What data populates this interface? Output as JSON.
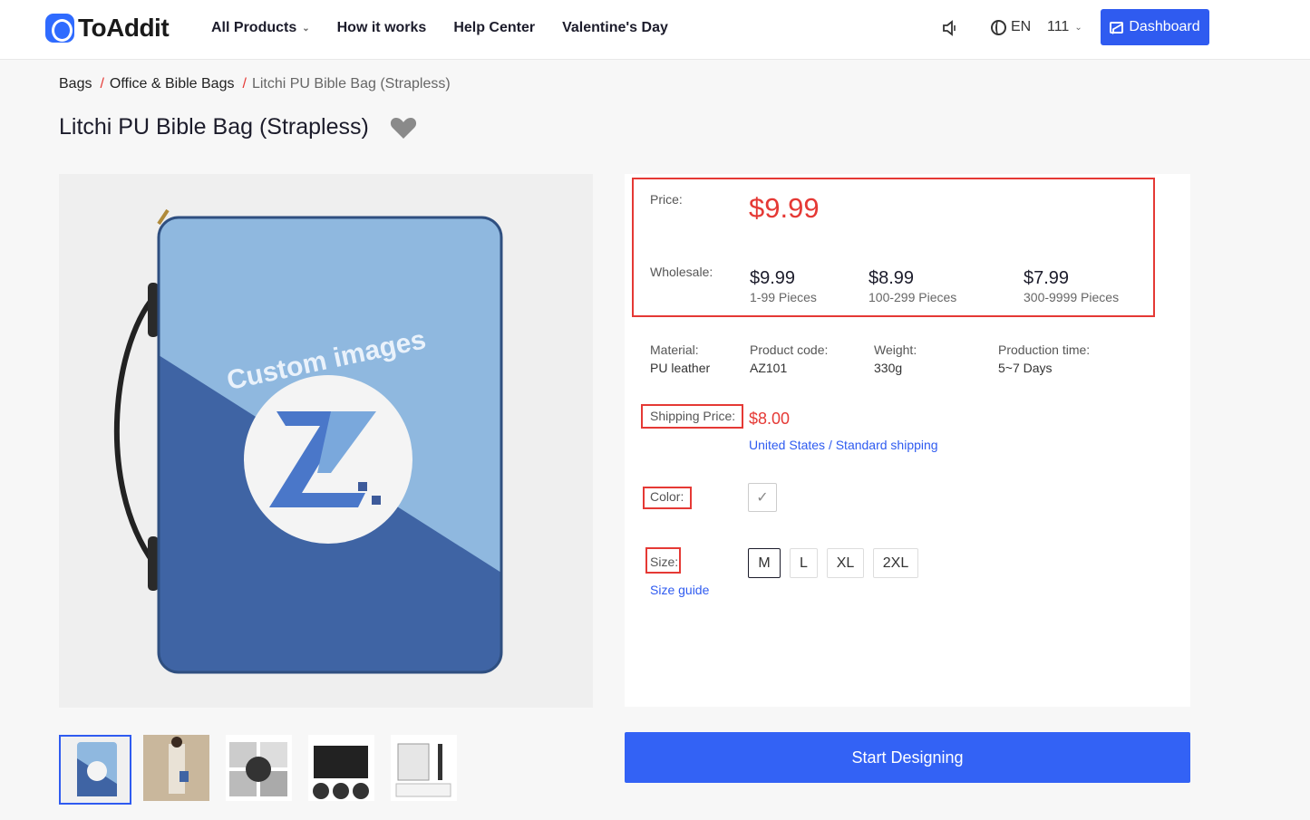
{
  "header": {
    "logo_text": "ToAddit",
    "nav": [
      {
        "label": "All Products",
        "has_dropdown": true
      },
      {
        "label": "How it works"
      },
      {
        "label": "Help Center"
      },
      {
        "label": "Valentine's Day"
      }
    ],
    "language": "EN",
    "user": "111",
    "dashboard_label": "Dashboard",
    "accent_color": "#2f5bf0"
  },
  "breadcrumb": {
    "items": [
      "Bags",
      "Office & Bible Bags"
    ],
    "separator": "/",
    "current": "Litchi PU Bible Bag (Strapless)"
  },
  "product": {
    "title": "Litchi PU Bible Bag (Strapless)",
    "image_text": "Custom images",
    "price_label": "Price:",
    "price": "$9.99",
    "wholesale_label": "Wholesale:",
    "wholesale": [
      {
        "price": "$9.99",
        "qty": "1-99 Pieces"
      },
      {
        "price": "$8.99",
        "qty": "100-299 Pieces"
      },
      {
        "price": "$7.99",
        "qty": "300-9999 Pieces"
      }
    ],
    "specs": [
      {
        "label": "Material:",
        "value": "PU leather"
      },
      {
        "label": "Product code:",
        "value": "AZ101"
      },
      {
        "label": "Weight:",
        "value": "330g"
      },
      {
        "label": "Production time:",
        "value": "5~7 Days"
      }
    ],
    "shipping_label": "Shipping Price:",
    "shipping_price": "$8.00",
    "shipping_method": "United States / Standard shipping",
    "color_label": "Color:",
    "size_label": "Size:",
    "sizes": [
      "M",
      "L",
      "XL",
      "2XL"
    ],
    "selected_size": "M",
    "size_guide": "Size guide",
    "start_button": "Start Designing",
    "price_color": "#e53935"
  }
}
